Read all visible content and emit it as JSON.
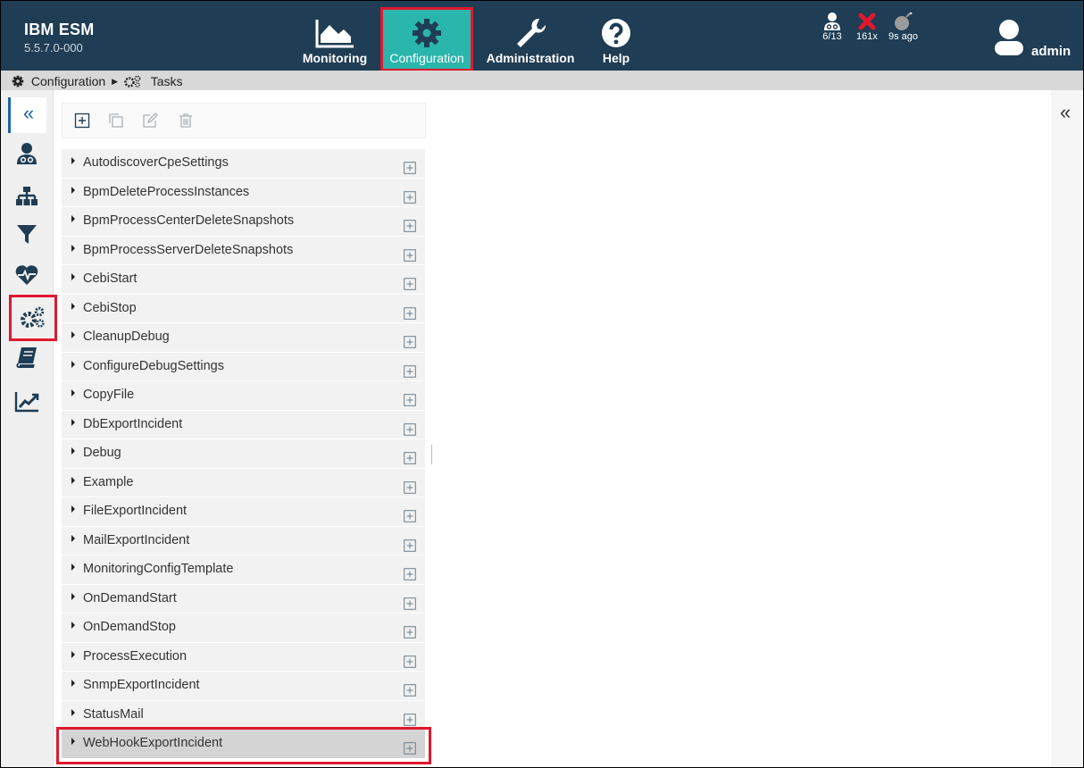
{
  "header": {
    "brand_name": "IBM ESM",
    "version": "5.5.7.0-000",
    "nav": [
      {
        "label": "Monitoring",
        "icon": "area-chart-icon"
      },
      {
        "label": "Configuration",
        "icon": "gear-icon"
      },
      {
        "label": "Administration",
        "icon": "wrench-icon"
      },
      {
        "label": "Help",
        "icon": "question-icon"
      }
    ],
    "status": {
      "agents": "6/13",
      "errors": "161x",
      "last_update": "9s ago"
    },
    "user": "admin"
  },
  "breadcrumb": {
    "root": "Configuration",
    "current": "Tasks"
  },
  "sidebar": {
    "collapse_glyph": "«",
    "items": [
      "agents-icon",
      "hierarchy-icon",
      "filter-icon",
      "heartbeat-icon",
      "tasks-gears-icon",
      "book-icon",
      "line-chart-icon"
    ],
    "selected": "tasks-gears-icon"
  },
  "right_collapse_glyph": "«",
  "tasks": [
    "AutodiscoverCpeSettings",
    "BpmDeleteProcessInstances",
    "BpmProcessCenterDeleteSnapshots",
    "BpmProcessServerDeleteSnapshots",
    "CebiStart",
    "CebiStop",
    "CleanupDebug",
    "ConfigureDebugSettings",
    "CopyFile",
    "DbExportIncident",
    "Debug",
    "Example",
    "FileExportIncident",
    "MailExportIncident",
    "MonitoringConfigTemplate",
    "OnDemandStart",
    "OnDemandStop",
    "ProcessExecution",
    "SnmpExportIncident",
    "StatusMail",
    "WebHookExportIncident"
  ],
  "selected_task": "WebHookExportIncident",
  "colors": {
    "header_bg": "#1f3d54",
    "active_nav_bg": "#2ab5ad",
    "highlight_red": "#e0182d",
    "link_blue": "#1f62a8"
  }
}
